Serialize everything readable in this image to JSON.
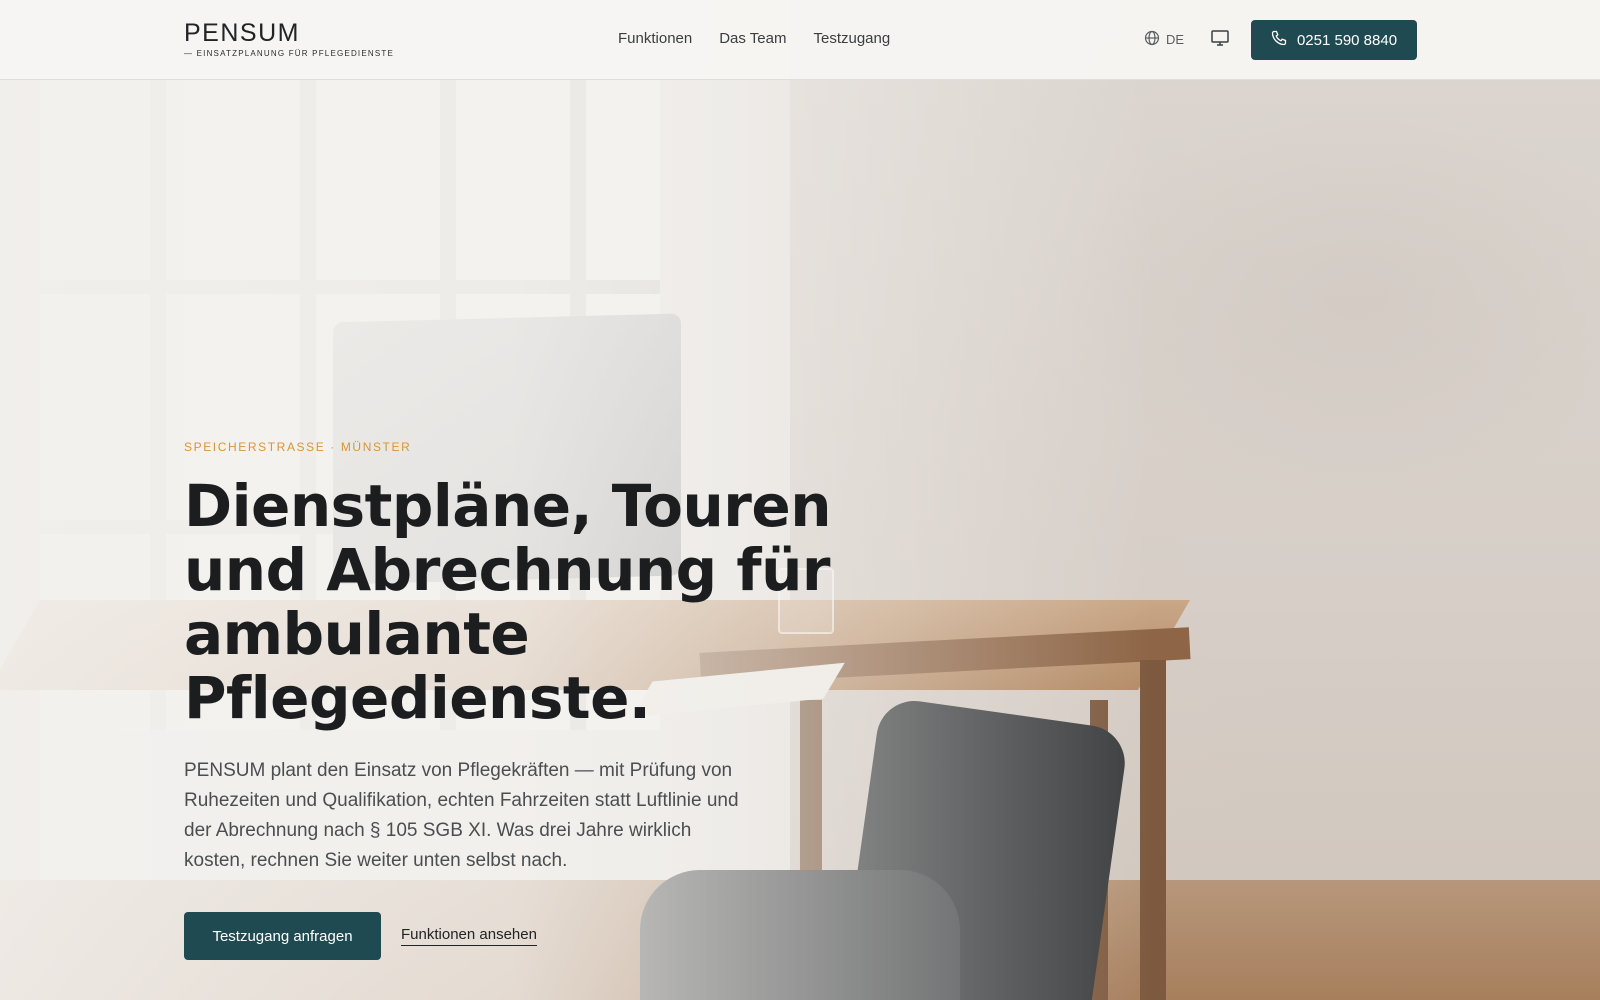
{
  "header": {
    "logo_name": "PENSUM",
    "logo_tagline": "— EINSATZPLANUNG FÜR PFLEGEDIENSTE",
    "nav": [
      {
        "label": "Funktionen"
      },
      {
        "label": "Das Team"
      },
      {
        "label": "Testzugang"
      }
    ],
    "language": "DE",
    "phone": "0251 590 8840",
    "icons": {
      "language": "globe-icon",
      "display": "monitor-icon",
      "phone": "phone-icon"
    }
  },
  "hero": {
    "eyebrow": "SPEICHERSTRASSE · MÜNSTER",
    "title_line1": "Dienstpläne, Touren",
    "title_line2": "und Abrechnung für",
    "title_line3": "ambulante Pflegedienste.",
    "lead": "PENSUM plant den Einsatz von Pflegekräften — mit Prüfung von Ruhezeiten und Qualifikation, echten Fahrzeiten statt Luftlinie und der Abrechnung nach § 105 SGB XI. Was drei Jahre wirklich kosten, rechnen Sie weiter unten selbst nach.",
    "primary_cta": "Testzugang anfragen",
    "secondary_cta": "Funktionen ansehen"
  },
  "colors": {
    "accent": "#1f4a52",
    "eyebrow": "#d7953a",
    "text": "#1b1d1f"
  }
}
